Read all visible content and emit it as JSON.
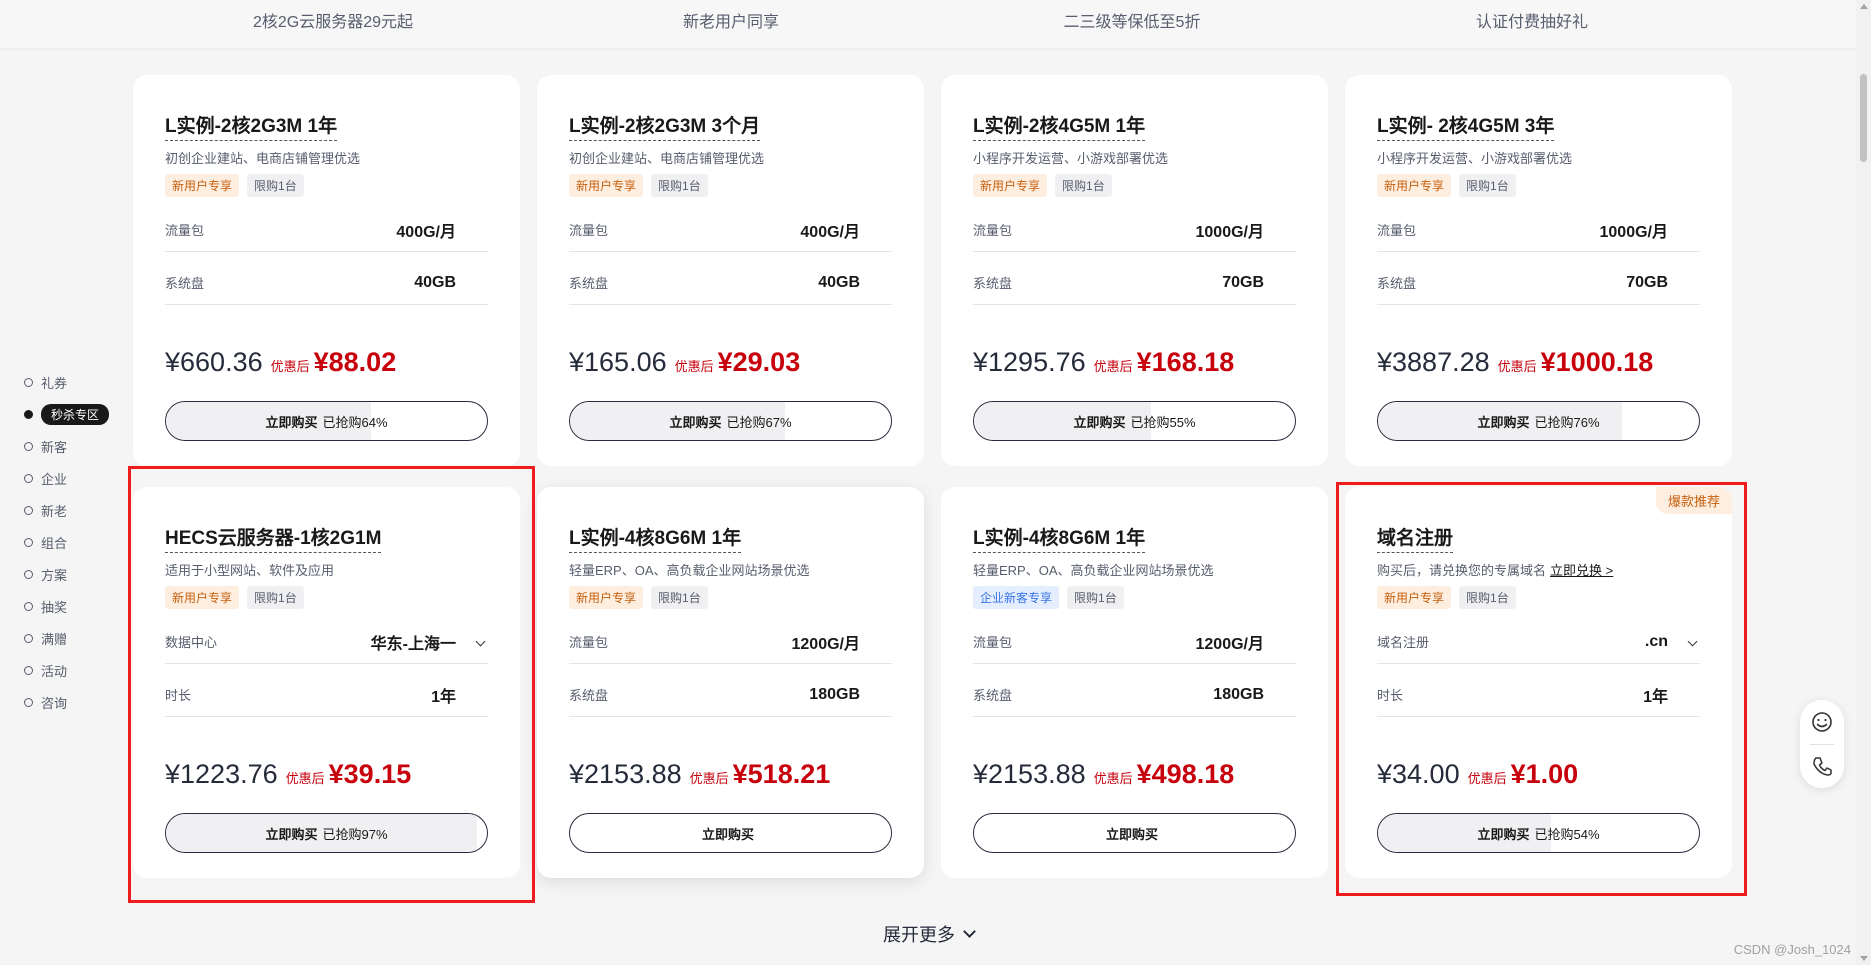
{
  "topbar": [
    "2核2G云服务器29元起",
    "新老用户同享",
    "二三级等保低至5折",
    "认证付费抽好礼"
  ],
  "sidenav": [
    {
      "label": "礼券",
      "active": false
    },
    {
      "label": "秒杀专区",
      "active": true
    },
    {
      "label": "新客",
      "active": false
    },
    {
      "label": "企业",
      "active": false
    },
    {
      "label": "新老",
      "active": false
    },
    {
      "label": "组合",
      "active": false
    },
    {
      "label": "方案",
      "active": false
    },
    {
      "label": "抽奖",
      "active": false
    },
    {
      "label": "满赠",
      "active": false
    },
    {
      "label": "活动",
      "active": false
    },
    {
      "label": "咨询",
      "active": false
    }
  ],
  "cards": [
    {
      "title": "L实例-2核2G3M 1年",
      "subtitle": "初创企业建站、电商店铺管理优选",
      "tags": [
        {
          "text": "新用户专享",
          "style": "orange"
        },
        {
          "text": "限购1台",
          "style": "gray"
        }
      ],
      "specs": [
        {
          "label": "流量包",
          "value": "400G/月"
        },
        {
          "label": "系统盘",
          "value": "40GB"
        }
      ],
      "price_original": "¥660.36",
      "after_label": "优惠后",
      "price_final": "¥88.02",
      "buy_label": "立即购买",
      "progress_text": "已抢购64%",
      "progress": 0.64
    },
    {
      "title": "L实例-2核2G3M 3个月",
      "subtitle": "初创企业建站、电商店铺管理优选",
      "tags": [
        {
          "text": "新用户专享",
          "style": "orange"
        },
        {
          "text": "限购1台",
          "style": "gray"
        }
      ],
      "specs": [
        {
          "label": "流量包",
          "value": "400G/月"
        },
        {
          "label": "系统盘",
          "value": "40GB"
        }
      ],
      "price_original": "¥165.06",
      "after_label": "优惠后",
      "price_final": "¥29.03",
      "buy_label": "立即购买",
      "progress_text": "已抢购67%",
      "progress": 0.67
    },
    {
      "title": "L实例-2核4G5M 1年",
      "subtitle": "小程序开发运营、小游戏部署优选",
      "tags": [
        {
          "text": "新用户专享",
          "style": "orange"
        },
        {
          "text": "限购1台",
          "style": "gray"
        }
      ],
      "specs": [
        {
          "label": "流量包",
          "value": "1000G/月"
        },
        {
          "label": "系统盘",
          "value": "70GB"
        }
      ],
      "price_original": "¥1295.76",
      "after_label": "优惠后",
      "price_final": "¥168.18",
      "buy_label": "立即购买",
      "progress_text": "已抢购55%",
      "progress": 0.55
    },
    {
      "title": "L实例- 2核4G5M 3年",
      "subtitle": "小程序开发运营、小游戏部署优选",
      "tags": [
        {
          "text": "新用户专享",
          "style": "orange"
        },
        {
          "text": "限购1台",
          "style": "gray"
        }
      ],
      "specs": [
        {
          "label": "流量包",
          "value": "1000G/月"
        },
        {
          "label": "系统盘",
          "value": "70GB"
        }
      ],
      "price_original": "¥3887.28",
      "after_label": "优惠后",
      "price_final": "¥1000.18",
      "buy_label": "立即购买",
      "progress_text": "已抢购76%",
      "progress": 0.76
    },
    {
      "title": "HECS云服务器-1核2G1M",
      "subtitle": "适用于小型网站、软件及应用",
      "tags": [
        {
          "text": "新用户专享",
          "style": "orange"
        },
        {
          "text": "限购1台",
          "style": "gray"
        }
      ],
      "specs": [
        {
          "label": "数据中心",
          "value": "华东-上海一",
          "dropdown": true
        },
        {
          "label": "时长",
          "value": "1年"
        }
      ],
      "price_original": "¥1223.76",
      "after_label": "优惠后",
      "price_final": "¥39.15",
      "buy_label": "立即购买",
      "progress_text": "已抢购97%",
      "progress": 0.97
    },
    {
      "title": "L实例-4核8G6M 1年",
      "subtitle": "轻量ERP、OA、高负载企业网站场景优选",
      "tags": [
        {
          "text": "新用户专享",
          "style": "orange"
        },
        {
          "text": "限购1台",
          "style": "gray"
        }
      ],
      "specs": [
        {
          "label": "流量包",
          "value": "1200G/月"
        },
        {
          "label": "系统盘",
          "value": "180GB"
        }
      ],
      "price_original": "¥2153.88",
      "after_label": "优惠后",
      "price_final": "¥518.21",
      "buy_label": "立即购买",
      "progress_text": "",
      "progress": 0
    },
    {
      "title": "L实例-4核8G6M 1年",
      "subtitle": "轻量ERP、OA、高负载企业网站场景优选",
      "tags": [
        {
          "text": "企业新客专享",
          "style": "blue"
        },
        {
          "text": "限购1台",
          "style": "gray"
        }
      ],
      "specs": [
        {
          "label": "流量包",
          "value": "1200G/月"
        },
        {
          "label": "系统盘",
          "value": "180GB"
        }
      ],
      "price_original": "¥2153.88",
      "after_label": "优惠后",
      "price_final": "¥498.18",
      "buy_label": "立即购买",
      "progress_text": "",
      "progress": 0
    },
    {
      "title": "域名注册",
      "subtitle": "购买后，请兑换您的专属域名",
      "subtitle_link": "立即兑换 >",
      "ribbon": "爆款推荐",
      "tags": [
        {
          "text": "新用户专享",
          "style": "orange"
        },
        {
          "text": "限购1台",
          "style": "gray"
        }
      ],
      "specs": [
        {
          "label": "域名注册",
          "value": ".cn",
          "dropdown": true
        },
        {
          "label": "时长",
          "value": "1年"
        }
      ],
      "price_original": "¥34.00",
      "after_label": "优惠后",
      "price_final": "¥1.00",
      "buy_label": "立即购买",
      "progress_text": "已抢购54%",
      "progress": 0.54
    }
  ],
  "expand_label": "展开更多",
  "watermark": "CSDN @Josh_1024",
  "colors": {
    "accent_red": "#c7000b",
    "highlight_border": "#ee1c1c",
    "tag_orange": "#c6600e",
    "tag_blue": "#3a74e6"
  },
  "icons": {
    "float_top": "smile-icon",
    "float_bottom": "phone-icon",
    "expand": "chevron-down-icon"
  }
}
